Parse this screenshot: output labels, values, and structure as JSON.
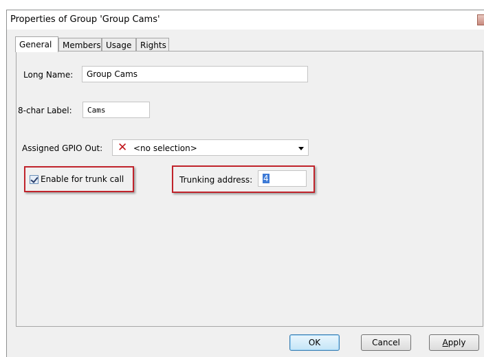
{
  "window": {
    "title": "Properties of Group 'Group Cams'"
  },
  "tabs": [
    {
      "label": "General",
      "active": true
    },
    {
      "label": "Members",
      "active": false
    },
    {
      "label": "Usage",
      "active": false
    },
    {
      "label": "Rights",
      "active": false
    }
  ],
  "form": {
    "long_name": {
      "label": "Long Name:",
      "value": "Group Cams"
    },
    "short_label": {
      "label": "8-char Label:",
      "value": "Cams"
    },
    "gpio_out": {
      "label": "Assigned GPIO Out:",
      "value": "<no selection>",
      "icon": "red-x-icon"
    },
    "enable_trunk": {
      "label": "Enable for trunk call",
      "checked": true
    },
    "trunking_address": {
      "label": "Trunking address:",
      "value": "4"
    }
  },
  "buttons": {
    "ok": "OK",
    "cancel": "Cancel",
    "apply_prefix": "",
    "apply_underlined": "A",
    "apply_rest": "pply"
  },
  "colors": {
    "highlight": "#c0222a",
    "dialog_bg": "#f0f0f0",
    "selection": "#3d7ad6"
  }
}
